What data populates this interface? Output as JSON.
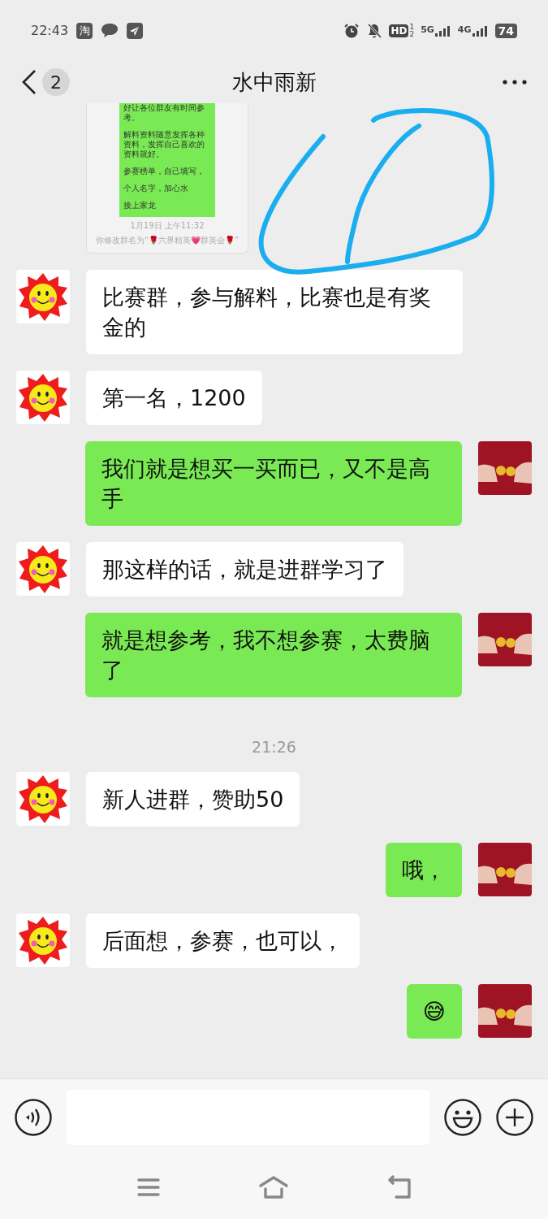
{
  "status_bar": {
    "time": "22:43",
    "app_badge": "淘",
    "hd_label": "HD",
    "hd_index": "1",
    "hd_sub": "2",
    "networks": [
      "5G",
      "4G"
    ],
    "battery": "74"
  },
  "header": {
    "unread_count": "2",
    "title": "水中雨新"
  },
  "messages": [
    {
      "kind": "image",
      "lines": [
        "好让各位群友有时间参考。",
        "解料资料随意发挥各种资料，发挥自己喜欢的资料就好。",
        "参赛榜单，自己填写，",
        "个人名字，加心水",
        "接上家龙"
      ],
      "image_time": "1月19日 上午11:32",
      "image_notice": "你修改群名为“🌹六界精英💗群英会🌹”"
    },
    {
      "kind": "incoming",
      "text": "比赛群，参与解料，比赛也是有奖金的"
    },
    {
      "kind": "incoming",
      "text": "第一名，1200"
    },
    {
      "kind": "outgoing",
      "text": "我们就是想买一买而已，又不是高手"
    },
    {
      "kind": "incoming",
      "text": "那这样的话，就是进群学习了"
    },
    {
      "kind": "outgoing",
      "text": "就是想参考，我不想参赛，太费脑了"
    },
    {
      "kind": "time",
      "text": "21:26"
    },
    {
      "kind": "incoming",
      "text": "新人进群，赞助50"
    },
    {
      "kind": "outgoing",
      "text": "哦，"
    },
    {
      "kind": "incoming",
      "text": "后面想，参赛，也可以，"
    },
    {
      "kind": "outgoing",
      "text": "😅"
    }
  ]
}
